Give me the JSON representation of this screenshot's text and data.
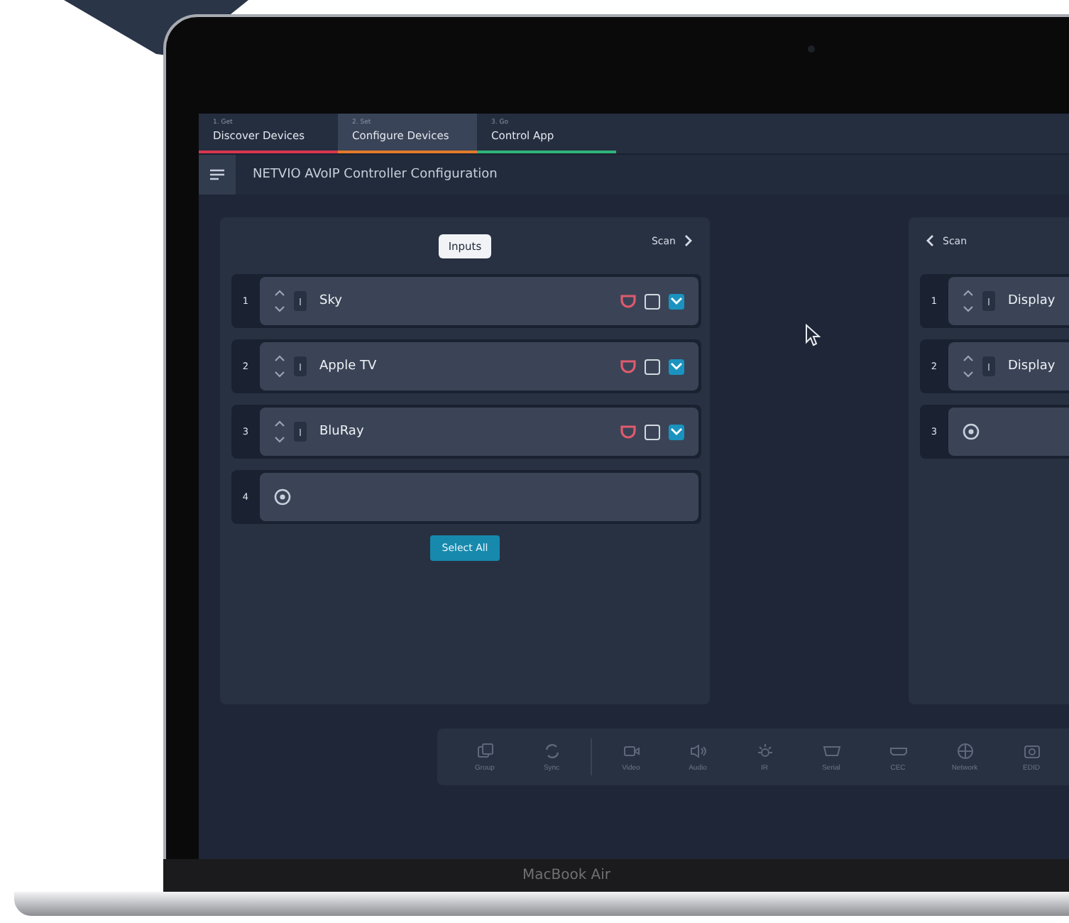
{
  "device_label": "MacBook Air",
  "tabs": [
    {
      "step": "1. Get",
      "label": "Discover Devices",
      "selected": false,
      "color": "#d8364f"
    },
    {
      "step": "2. Set",
      "label": "Configure Devices",
      "selected": true,
      "color": "#e07a2a"
    },
    {
      "step": "3. Go",
      "label": "Control App",
      "selected": false,
      "color": "#2fb37a"
    }
  ],
  "header": {
    "title": "NETVIO AVoIP Controller Configuration"
  },
  "inputs_panel": {
    "title": "Inputs",
    "scan": "Scan",
    "select_all": "Select All",
    "rows": [
      {
        "kind": "device",
        "number": "1",
        "name": "Sky",
        "checked_a": false,
        "checked_b": true
      },
      {
        "kind": "device",
        "number": "2",
        "name": "Apple TV",
        "checked_a": false,
        "checked_b": true
      },
      {
        "kind": "device",
        "number": "3",
        "name": "BluRay",
        "checked_a": false,
        "checked_b": true
      },
      {
        "kind": "add",
        "number": "4"
      }
    ]
  },
  "outputs_panel": {
    "scan": "Scan",
    "rows": [
      {
        "kind": "device",
        "number": "1",
        "name": "Display"
      },
      {
        "kind": "device",
        "number": "2",
        "name": "Display"
      },
      {
        "kind": "add",
        "number": "3"
      }
    ]
  },
  "toolbar": [
    {
      "kind": "group",
      "label": "Group"
    },
    {
      "kind": "sync",
      "label": "Sync"
    },
    {
      "kind": "divider"
    },
    {
      "kind": "video",
      "label": "Video"
    },
    {
      "kind": "audio",
      "label": "Audio"
    },
    {
      "kind": "ir",
      "label": "IR"
    },
    {
      "kind": "serial",
      "label": "Serial"
    },
    {
      "kind": "cec",
      "label": "CEC"
    },
    {
      "kind": "network",
      "label": "Network"
    },
    {
      "kind": "edid",
      "label": "EDID"
    }
  ]
}
